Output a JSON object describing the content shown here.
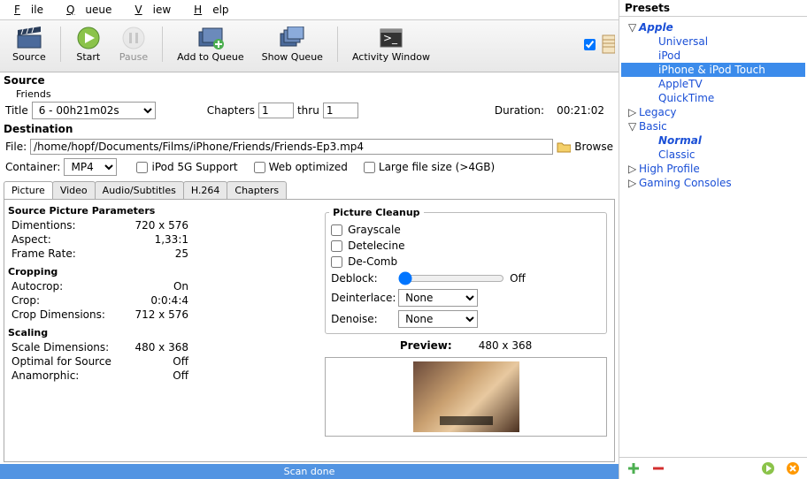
{
  "menu": {
    "file": "File",
    "queue": "Queue",
    "view": "View",
    "help": "Help"
  },
  "toolbar": {
    "source": "Source",
    "start": "Start",
    "pause": "Pause",
    "add": "Add to Queue",
    "show": "Show Queue",
    "activity": "Activity Window"
  },
  "source": {
    "title": "Source",
    "name": "Friends"
  },
  "title_row": {
    "label": "Title",
    "value": "6 - 00h21m02s",
    "chapters": "Chapters",
    "from": "1",
    "thru": "thru",
    "to": "1",
    "duration_lbl": "Duration:",
    "duration": "00:21:02"
  },
  "destination": {
    "title": "Destination",
    "file_lbl": "File:",
    "file": "/home/hopf/Documents/Films/iPhone/Friends/Friends-Ep3.mp4",
    "browse": "Browse"
  },
  "format": {
    "container_lbl": "Container:",
    "container": "MP4",
    "ipod": "iPod 5G Support",
    "web": "Web optimized",
    "large": "Large file size (>4GB)"
  },
  "tabs": [
    "Picture",
    "Video",
    "Audio/Subtitles",
    "H.264",
    "Chapters"
  ],
  "picture": {
    "spp": "Source Picture Parameters",
    "dim_k": "Dimentions:",
    "dim_v": "720 x 576",
    "aspect_k": "Aspect:",
    "aspect_v": "1,33:1",
    "fr_k": "Frame Rate:",
    "fr_v": "25",
    "crop_t": "Cropping",
    "autocrop_k": "Autocrop:",
    "autocrop_v": "On",
    "crop_k": "Crop:",
    "crop_v": "0:0:4:4",
    "cropdim_k": "Crop Dimensions:",
    "cropdim_v": "712 x 576",
    "scale_t": "Scaling",
    "scaledim_k": "Scale Dimensions:",
    "scaledim_v": "480 x 368",
    "opt_k": "Optimal for Source",
    "opt_v": "Off",
    "ana_k": "Anamorphic:",
    "ana_v": "Off"
  },
  "cleanup": {
    "title": "Picture Cleanup",
    "grayscale": "Grayscale",
    "detelecine": "Detelecine",
    "decomb": "De-Comb",
    "deblock_lbl": "Deblock:",
    "deblock_val": "Off",
    "deint_lbl": "Deinterlace:",
    "deint_val": "None",
    "denoise_lbl": "Denoise:",
    "denoise_val": "None",
    "preview_lbl": "Preview:",
    "preview_val": "480 x 368"
  },
  "status": "Scan done",
  "presets": {
    "title": "Presets",
    "nodes": [
      {
        "label": "Apple",
        "expanded": true,
        "bold": true,
        "children": [
          "Universal",
          "iPod",
          "iPhone & iPod Touch",
          "AppleTV",
          "QuickTime"
        ]
      },
      {
        "label": "Legacy",
        "expanded": false,
        "bold": false
      },
      {
        "label": "Basic",
        "expanded": true,
        "bold": false,
        "children": [
          "Normal",
          "Classic"
        ],
        "bold_child": "Normal"
      },
      {
        "label": "High Profile",
        "expanded": false,
        "bold": false
      },
      {
        "label": "Gaming Consoles",
        "expanded": false,
        "bold": false
      }
    ],
    "selected": "iPhone & iPod Touch"
  }
}
